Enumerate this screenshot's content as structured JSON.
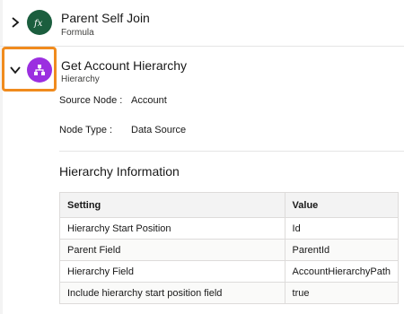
{
  "nodes": [
    {
      "title": "Parent Self Join",
      "subtitle": "Formula",
      "icon": "formula-icon",
      "expanded": false,
      "color": "#1b5e3e"
    },
    {
      "title": "Get Account Hierarchy",
      "subtitle": "Hierarchy",
      "icon": "hierarchy-icon",
      "expanded": true,
      "color": "#9b2fe0"
    }
  ],
  "details": {
    "source_node_label": "Source Node :",
    "source_node_value": "Account",
    "node_type_label": "Node Type :",
    "node_type_value": "Data Source"
  },
  "hierarchy": {
    "section_title": "Hierarchy Information",
    "columns": [
      "Setting",
      "Value"
    ],
    "rows": [
      [
        "Hierarchy Start Position",
        "Id"
      ],
      [
        "Parent Field",
        "ParentId"
      ],
      [
        "Hierarchy Field",
        "AccountHierarchyPath"
      ],
      [
        "Include hierarchy start position field",
        "true"
      ]
    ]
  },
  "colors": {
    "highlight": "#f08b1e",
    "formula": "#1b5e3e",
    "hierarchy": "#9b2fe0"
  }
}
